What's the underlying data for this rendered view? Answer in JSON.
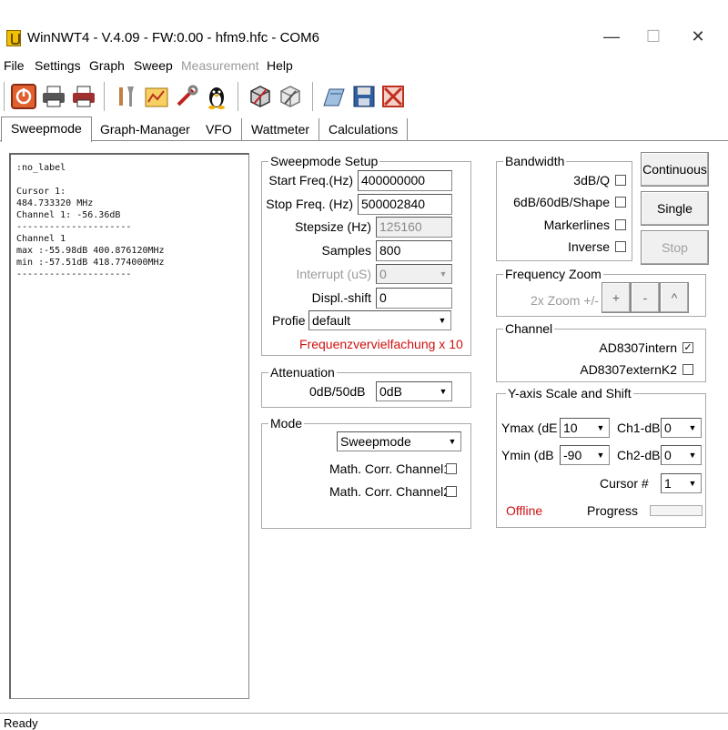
{
  "window": {
    "title": "WinNWT4 - V.4.09 - FW:0.00 - hfm9.hfc - COM6",
    "minimize": "—",
    "maximize": "☐",
    "close": "✕"
  },
  "menu": [
    {
      "label": "File"
    },
    {
      "label": "Settings"
    },
    {
      "label": "Graph"
    },
    {
      "label": "Sweep"
    },
    {
      "label": "Measurement"
    },
    {
      "label": "Help"
    }
  ],
  "toolbar_icons": [
    "power-icon",
    "printer-icon",
    "printer-color-icon",
    "tools-icon",
    "folder-chart-icon",
    "wrench-icon",
    "linux-penguin-icon",
    "cube-icon",
    "cube-settings-icon",
    "open-file-icon",
    "save-icon",
    "delete-icon"
  ],
  "tabs": [
    {
      "label": "Sweepmode"
    },
    {
      "label": "Graph-Manager"
    },
    {
      "label": "VFO"
    },
    {
      "label": "Wattmeter"
    },
    {
      "label": "Calculations"
    }
  ],
  "output_text": ":no_label\n\nCursor 1:\n484.733320 MHz\nChannel 1: -56.36dB\n---------------------\nChannel 1\nmax :-55.98dB 400.876120MHz\nmin :-57.51dB 418.774000MHz\n---------------------",
  "sweep_setup": {
    "title": "Sweepmode Setup",
    "start_label": "Start Freq.(Hz)",
    "start_value": "400000000",
    "stop_label": "Stop Freq. (Hz)",
    "stop_value": "500002840",
    "stepsize_label": "Stepsize (Hz)",
    "stepsize_value": "125160",
    "samples_label": "Samples",
    "samples_value": "800",
    "interrupt_label": "Interrupt (uS)",
    "interrupt_value": "0",
    "displshift_label": "Displ.-shift",
    "displshift_value": "0",
    "profile_label": "Profie",
    "profile_value": "default",
    "note": "Frequenzvervielfachung x 10"
  },
  "attenuation": {
    "title": "Attenuation",
    "label": "0dB/50dB",
    "value": "0dB"
  },
  "mode": {
    "title": "Mode",
    "value": "Sweepmode",
    "corr1": "Math. Corr. Channel1",
    "corr2": "Math. Corr. Channel2"
  },
  "bandwidth": {
    "title": "Bandwidth",
    "items": [
      "3dB/Q",
      "6dB/60dB/Shape",
      "Markerlines",
      "Inverse"
    ]
  },
  "buttons": {
    "continuous": "Continuous",
    "single": "Single",
    "stop": "Stop"
  },
  "freq_zoom": {
    "title": "Frequency Zoom",
    "label": "2x Zoom +/-",
    "plus": "+",
    "minus": "-",
    "reset": "^"
  },
  "channel": {
    "title": "Channel",
    "intern": "AD8307intern",
    "intern_checked": "✓",
    "extern": "AD8307externK2"
  },
  "yaxis": {
    "title": "Y-axis Scale and Shift",
    "ymax_label": "Ymax (dE",
    "ymax_value": "10",
    "ymin_label": "Ymin (dB",
    "ymin_value": "-90",
    "ch1_label": "Ch1-dB",
    "ch1_value": "0",
    "ch2_label": "Ch2-dB",
    "ch2_value": "0",
    "cursor_label": "Cursor #",
    "cursor_value": "1",
    "offline": "Offline",
    "progress_label": "Progress"
  },
  "status": {
    "text": "Ready"
  },
  "colors": {
    "accent_red": "#d01010"
  }
}
